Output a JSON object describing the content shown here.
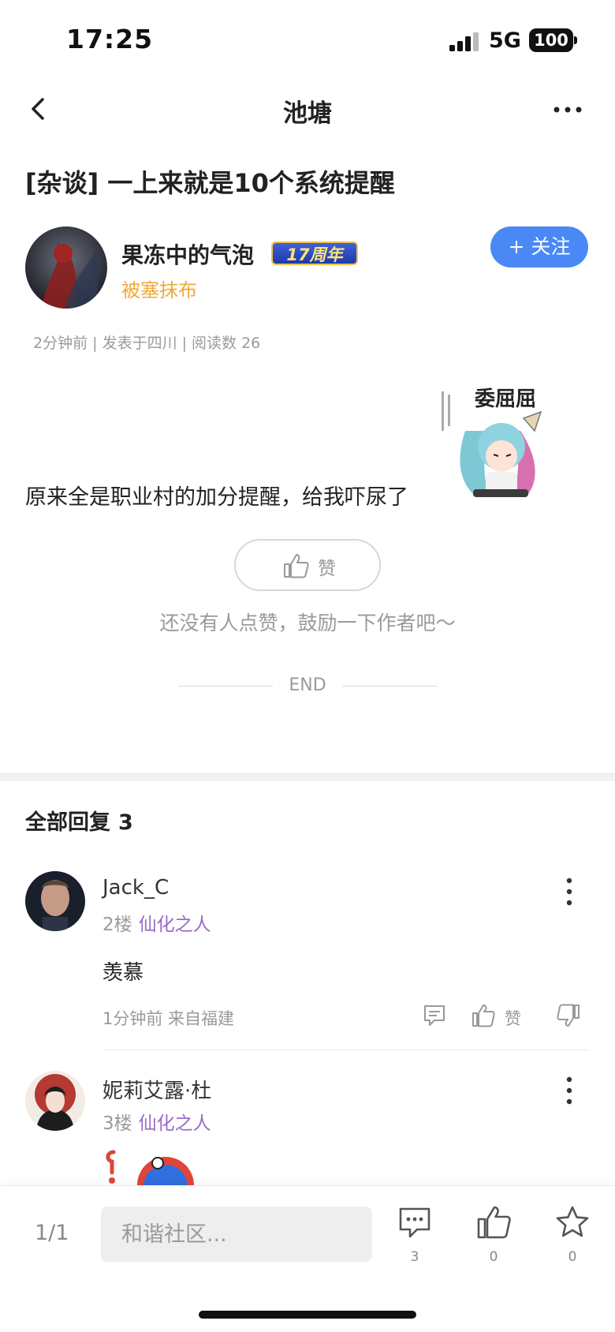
{
  "status_bar": {
    "time": "17:25",
    "network": "5G",
    "battery": "100"
  },
  "nav": {
    "title": "池塘"
  },
  "post": {
    "title": "[杂谈] 一上来就是10个系统提醒",
    "author": {
      "name": "果冻中的气泡",
      "badge": "17周年",
      "subtitle": "被塞抹布"
    },
    "follow_label": "+ 关注",
    "meta": "2分钟前 | 发表于四川 | 阅读数 26",
    "body": "原来全是职业村的加分提醒，给我吓尿了",
    "like_label": "赞",
    "like_hint": "还没有人点赞，鼓励一下作者吧～",
    "end_label": "END"
  },
  "replies": {
    "header": "全部回复",
    "count": "3",
    "items": [
      {
        "name": "Jack_C",
        "floor": "2楼",
        "rank": "仙化之人",
        "text": "羡慕",
        "meta": "1分钟前 来自福建",
        "like_label": "赞"
      },
      {
        "name": "妮莉艾露·杜",
        "floor": "3楼",
        "rank": "仙化之人"
      }
    ]
  },
  "bottom_bar": {
    "page": "1/1",
    "input_placeholder": "和谐社区...",
    "comment_count": "3",
    "like_count": "0",
    "favorite_count": "0"
  },
  "colors": {
    "accent_blue": "#4a88f5",
    "author_sub": "#f0a93a",
    "rank_purple": "#9a6ac9"
  }
}
